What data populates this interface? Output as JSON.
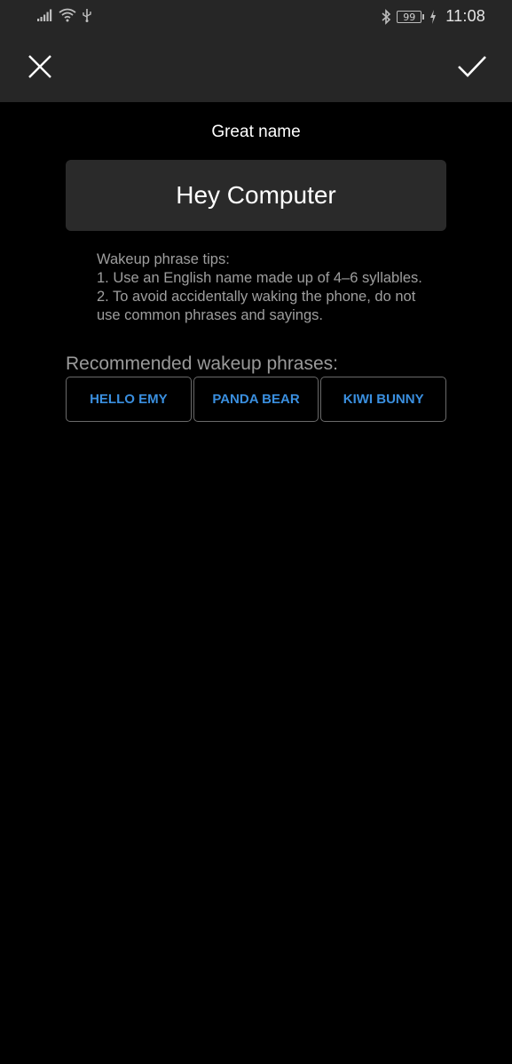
{
  "status_bar": {
    "battery_level": "99",
    "time": "11:08",
    "icons": [
      "signal-icon",
      "wifi-icon",
      "usb-icon",
      "bluetooth-icon",
      "battery-icon",
      "charging-icon"
    ]
  },
  "toolbar": {
    "close_icon": "close-icon",
    "confirm_icon": "checkmark-icon"
  },
  "header": {
    "subtitle": "Great name"
  },
  "name_field": {
    "value": "Hey Computer"
  },
  "tips": {
    "title": "Wakeup phrase tips:",
    "line1": "1. Use an English name made up of 4–6 syllables.",
    "line2": "2. To avoid accidentally waking the phone, do not use common phrases and sayings."
  },
  "recommended": {
    "label": "Recommended wakeup phrases:",
    "phrases": [
      "HELLO EMY",
      "PANDA BEAR",
      "KIWI BUNNY"
    ]
  },
  "colors": {
    "accent": "#3a8fdf",
    "bar_background": "#262626",
    "background": "#000000"
  }
}
